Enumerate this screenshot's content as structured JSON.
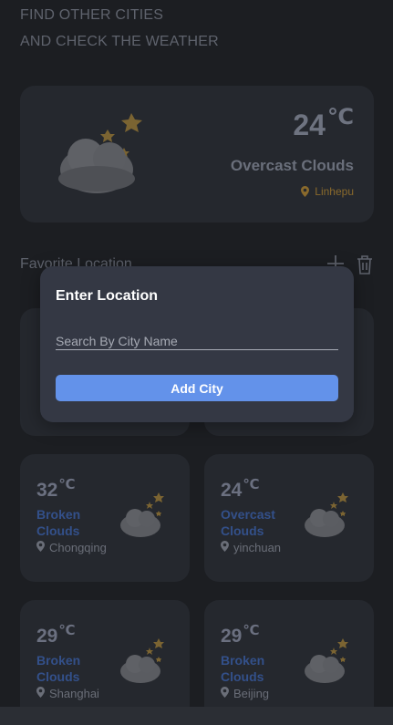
{
  "header": {
    "line1": "FIND OTHER CITIES",
    "line2": "AND CHECK THE WEATHER"
  },
  "current": {
    "temp": "24",
    "unit": "℃",
    "condition": "Overcast Clouds",
    "location": "Linhepu",
    "icon": "cloud-moon-stars-icon"
  },
  "favorites": {
    "title": "Favorite Location",
    "add_icon": "plus-icon",
    "delete_icon": "trash-icon",
    "cards": [
      {
        "temp": "32",
        "unit": "℃",
        "condition": "Broken Clouds",
        "location": "Chongqing"
      },
      {
        "temp": "24",
        "unit": "℃",
        "condition": "Overcast Clouds",
        "location": "yinchuan"
      },
      {
        "temp": "29",
        "unit": "℃",
        "condition": "Broken Clouds",
        "location": "Shanghai"
      },
      {
        "temp": "29",
        "unit": "℃",
        "condition": "Broken Clouds",
        "location": "Beijing"
      }
    ]
  },
  "modal": {
    "title": "Enter Location",
    "placeholder": "Search By City Name",
    "value": "",
    "button": "Add City"
  },
  "colors": {
    "background": "#1c1e22",
    "card": "#25282e",
    "modal": "#343844",
    "accent": "#6392ea",
    "location_accent": "#8a6a2c"
  }
}
